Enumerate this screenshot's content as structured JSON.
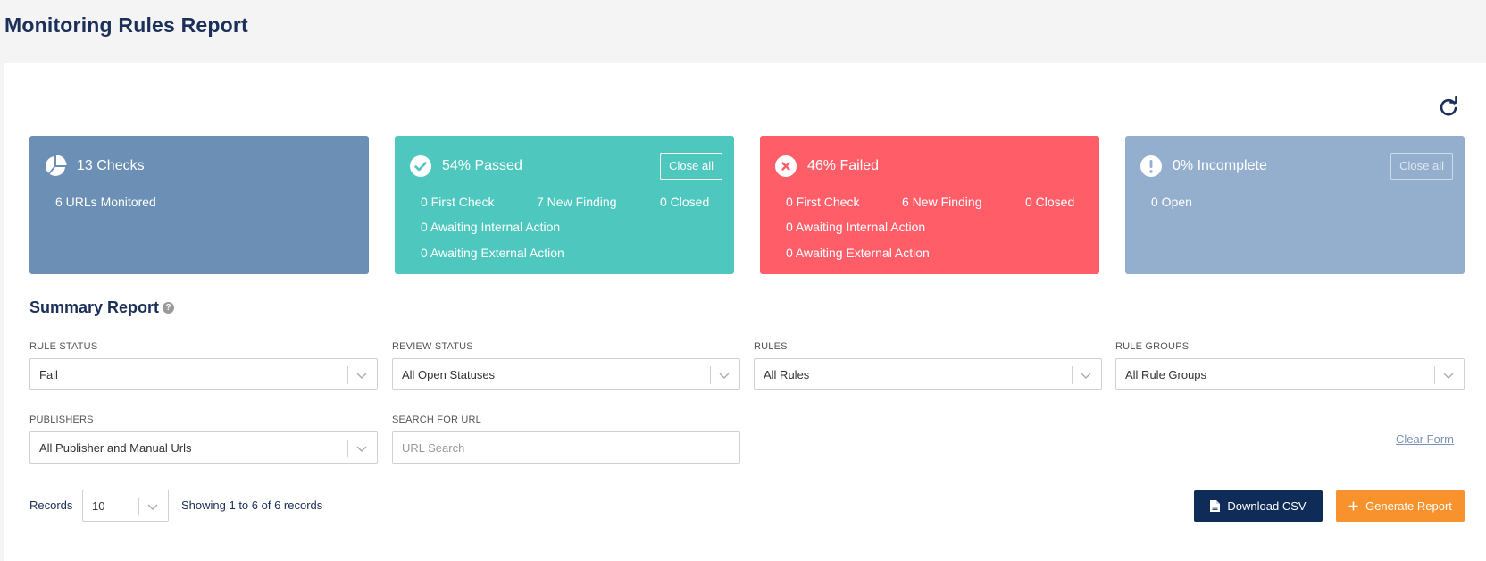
{
  "page": {
    "title": "Monitoring Rules Report"
  },
  "cards": {
    "checks": {
      "title": "13 Checks",
      "urls": "6 URLs Monitored",
      "icon": "pie-chart-icon",
      "color": "#6b8fb5"
    },
    "passed": {
      "title": "54% Passed",
      "close_label": "Close all",
      "icon": "check-circle-icon",
      "color": "#4ec8bf",
      "first_check": "0 First Check",
      "new_finding": "7 New Finding",
      "closed": "0 Closed",
      "awaiting_internal": "0 Awaiting Internal Action",
      "awaiting_external": "0 Awaiting External Action"
    },
    "failed": {
      "title": "46% Failed",
      "icon": "x-circle-icon",
      "color": "#ff5e69",
      "first_check": "0 First Check",
      "new_finding": "6 New Finding",
      "closed": "0 Closed",
      "awaiting_internal": "0 Awaiting Internal Action",
      "awaiting_external": "0 Awaiting External Action"
    },
    "incomplete": {
      "title": "0% Incomplete",
      "close_label": "Close all",
      "open": "0 Open",
      "icon": "exclamation-circle-icon",
      "color": "#94aecd"
    }
  },
  "summary": {
    "title": "Summary Report",
    "filters": {
      "rule_status": {
        "label": "RULE STATUS",
        "value": "Fail"
      },
      "review_status": {
        "label": "REVIEW STATUS",
        "value": "All Open Statuses"
      },
      "rules": {
        "label": "RULES",
        "value": "All Rules"
      },
      "rule_groups": {
        "label": "RULE GROUPS",
        "value": "All Rule Groups"
      },
      "publishers": {
        "label": "PUBLISHERS",
        "value": "All Publisher and Manual Urls"
      },
      "url_search": {
        "label": "SEARCH FOR URL",
        "placeholder": "URL Search",
        "value": ""
      }
    },
    "clear_form": "Clear Form"
  },
  "footer": {
    "records_label": "Records",
    "records_value": "10",
    "showing": "Showing 1 to 6 of 6 records",
    "download_csv": "Download CSV",
    "generate_report": "Generate Report"
  },
  "colors": {
    "navy": "#1b2f59",
    "dark_button": "#0f2b57",
    "orange_button": "#f7922c"
  }
}
